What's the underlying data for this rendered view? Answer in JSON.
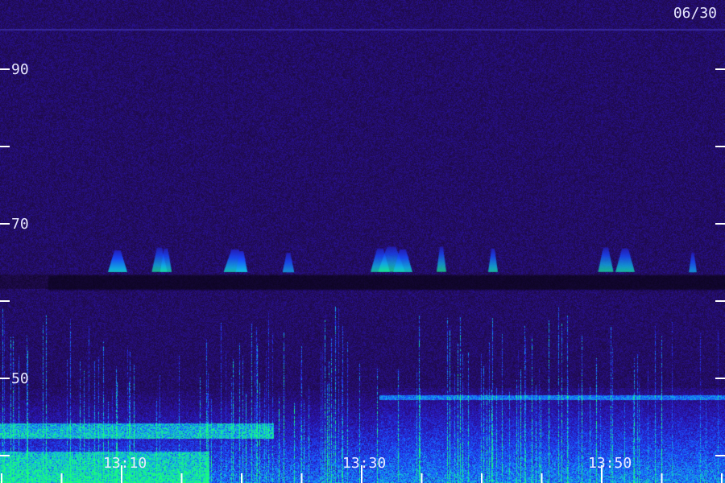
{
  "chart_data": {
    "type": "heatmap",
    "date_label": "06/30",
    "y_ticks": [
      90,
      70,
      50
    ],
    "y_minor_ticks": [
      80,
      60
    ],
    "x_ticks": [
      "13:10",
      "13:30",
      "13:50"
    ],
    "y_range": [
      41,
      102
    ],
    "colormap": [
      "#12062e",
      "#220c55",
      "#2a13b0",
      "#1a4dff",
      "#12b5e8",
      "#19ff7a"
    ],
    "features": {
      "low_frequency_band": [
        41,
        52
      ],
      "strong_band_center": 68
    }
  }
}
